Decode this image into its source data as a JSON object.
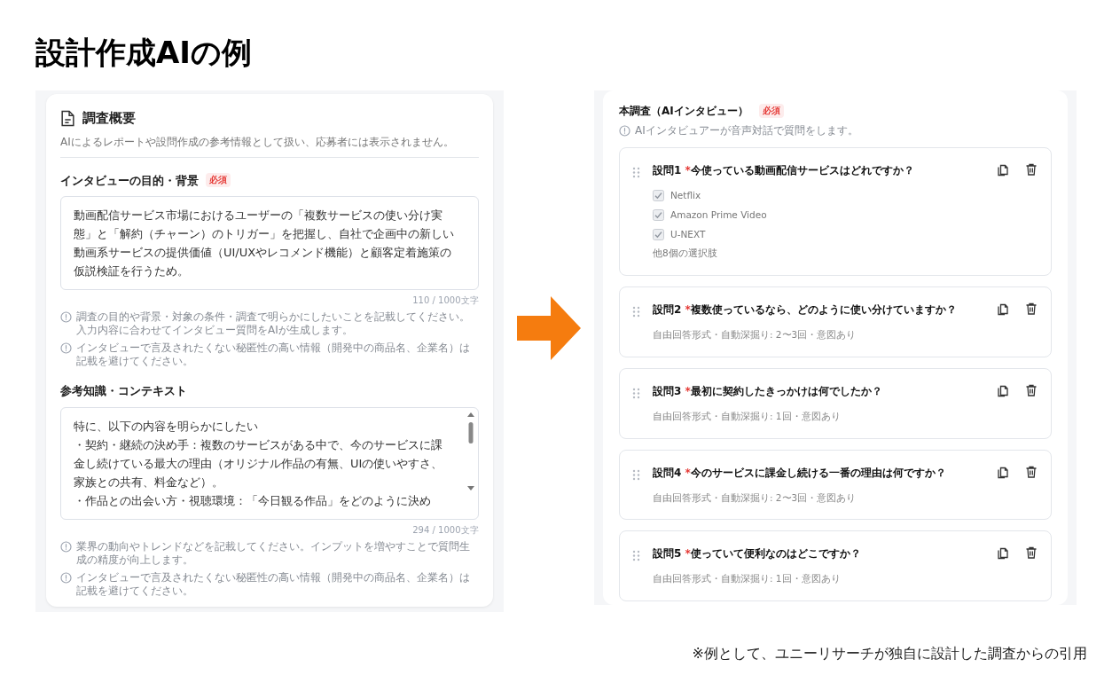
{
  "title": "設計作成AIの例",
  "left_panel": {
    "section_title": "調査概要",
    "section_description": "AIによるレポートや設問作成の参考情報として扱い、応募者には表示されません。",
    "fields": [
      {
        "label": "インタビューの目的・背景",
        "required_badge": "必須",
        "value": "動画配信サービス市場におけるユーザーの「複数サービスの使い分け実態」と「解約（チャーン）のトリガー」を把握し、自社で企画中の新しい動画系サービスの提供価値（UI/UXやレコメンド機能）と顧客定着施策の仮説検証を行うため。",
        "counter": "110 / 1000文字",
        "notes": [
          "調査の目的や背景・対象の条件・調査で明らかにしたいことを記載してください。入力内容に合わせてインタビュー質問をAIが生成します。",
          "インタビューで言及されたくない秘匿性の高い情報（開発中の商品名、企業名）は記載を避けてください。"
        ]
      },
      {
        "label": "参考知識・コンテキスト",
        "value_lines": [
          "特に、以下の内容を明らかにしたい",
          "・契約・継続の決め手：複数のサービスがある中で、今のサービスに課金し続けている最大の理由（オリジナル作品の有無、UIの使いやすさ、家族との共有、料金など）。",
          "・作品との出会い方・視聴環境：「今日観る作品」をどのように決め"
        ],
        "counter": "294 / 1000文字",
        "notes": [
          "業界の動向やトレンドなどを記載してください。インプットを増やすことで質問生成の精度が向上します。",
          "インタビューで言及されたくない秘匿性の高い情報（開発中の商品名、企業名）は記載を避けてください。"
        ]
      }
    ]
  },
  "right_panel": {
    "section_title": "本調査（AIインタビュー）",
    "required_badge": "必須",
    "note": "AIインタビュアーが音声対話で質問をします。",
    "questions": [
      {
        "kind": "choice",
        "number": "設問1",
        "required_mark": "*",
        "text": "今使っている動画配信サービスはどれですか？",
        "options": [
          {
            "label": "Netflix",
            "checked": true
          },
          {
            "label": "Amazon Prime Video",
            "checked": true
          },
          {
            "label": "U-NEXT",
            "checked": true
          }
        ],
        "more": "他8個の選択肢"
      },
      {
        "kind": "free",
        "number": "設問2",
        "required_mark": "*",
        "text": "複数使っているなら、どのように使い分けていますか？",
        "meta": "自由回答形式・自動深掘り: 2〜3回・意図あり"
      },
      {
        "kind": "free",
        "number": "設問3",
        "required_mark": "*",
        "text": "最初に契約したきっかけは何でしたか？",
        "meta": "自由回答形式・自動深掘り: 1回・意図あり"
      },
      {
        "kind": "free",
        "number": "設問4",
        "required_mark": "*",
        "text": "今のサービスに課金し続ける一番の理由は何ですか？",
        "meta": "自由回答形式・自動深掘り: 2〜3回・意図あり"
      },
      {
        "kind": "free",
        "number": "設問5",
        "required_mark": "*",
        "text": "使っていて便利なのはどこですか？",
        "meta": "自由回答形式・自動深掘り: 1回・意図あり"
      }
    ]
  },
  "footnote": "※例として、ユニーリサーチが独自に設計した調査からの引用"
}
